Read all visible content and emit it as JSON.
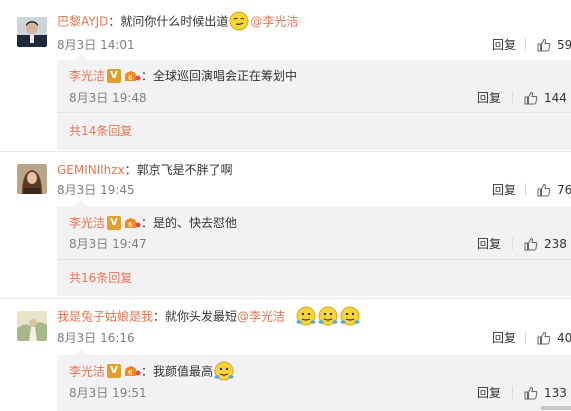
{
  "comments": [
    {
      "user": "巴黎AYJD",
      "text_before": "：就问你什么时候出道",
      "mention": "@李光洁",
      "emoji": "smirk-emoji",
      "time": "8月3日 14:01",
      "reply_label": "回复",
      "likes": "59",
      "sub_reply": {
        "user": "李光洁",
        "text": "：全球巡回演唱会正在筹划中",
        "time": "8月3日 19:48",
        "reply_label": "回复",
        "likes": "144"
      },
      "more_replies": "共14条回复"
    },
    {
      "user": "GEMINIlhzx",
      "text_before": "：郭京飞是不胖了啊",
      "time": "8月3日 19:45",
      "reply_label": "回复",
      "likes": "76",
      "sub_reply": {
        "user": "李光洁",
        "text": "：是的、快去怼他",
        "time": "8月3日 19:47",
        "reply_label": "回复",
        "likes": "238"
      },
      "more_replies": "共16条回复"
    },
    {
      "user": "我是兔子姑娘是我",
      "text_before": "：就你头发最短",
      "mention": "@李光洁",
      "emoji": "awkward-smile-emoji",
      "time": "8月3日 16:16",
      "reply_label": "回复",
      "likes": "40",
      "sub_reply": {
        "user": "李光洁",
        "text": "：我颜值最高",
        "time": "8月3日 19:51",
        "reply_label": "回复",
        "likes": "133"
      }
    }
  ],
  "badge_v_text": "V",
  "colors": {
    "username": "#eb7350",
    "meta": "#808080",
    "subbox_bg": "#f2f2f5",
    "badge_v": "#e0a12c"
  }
}
